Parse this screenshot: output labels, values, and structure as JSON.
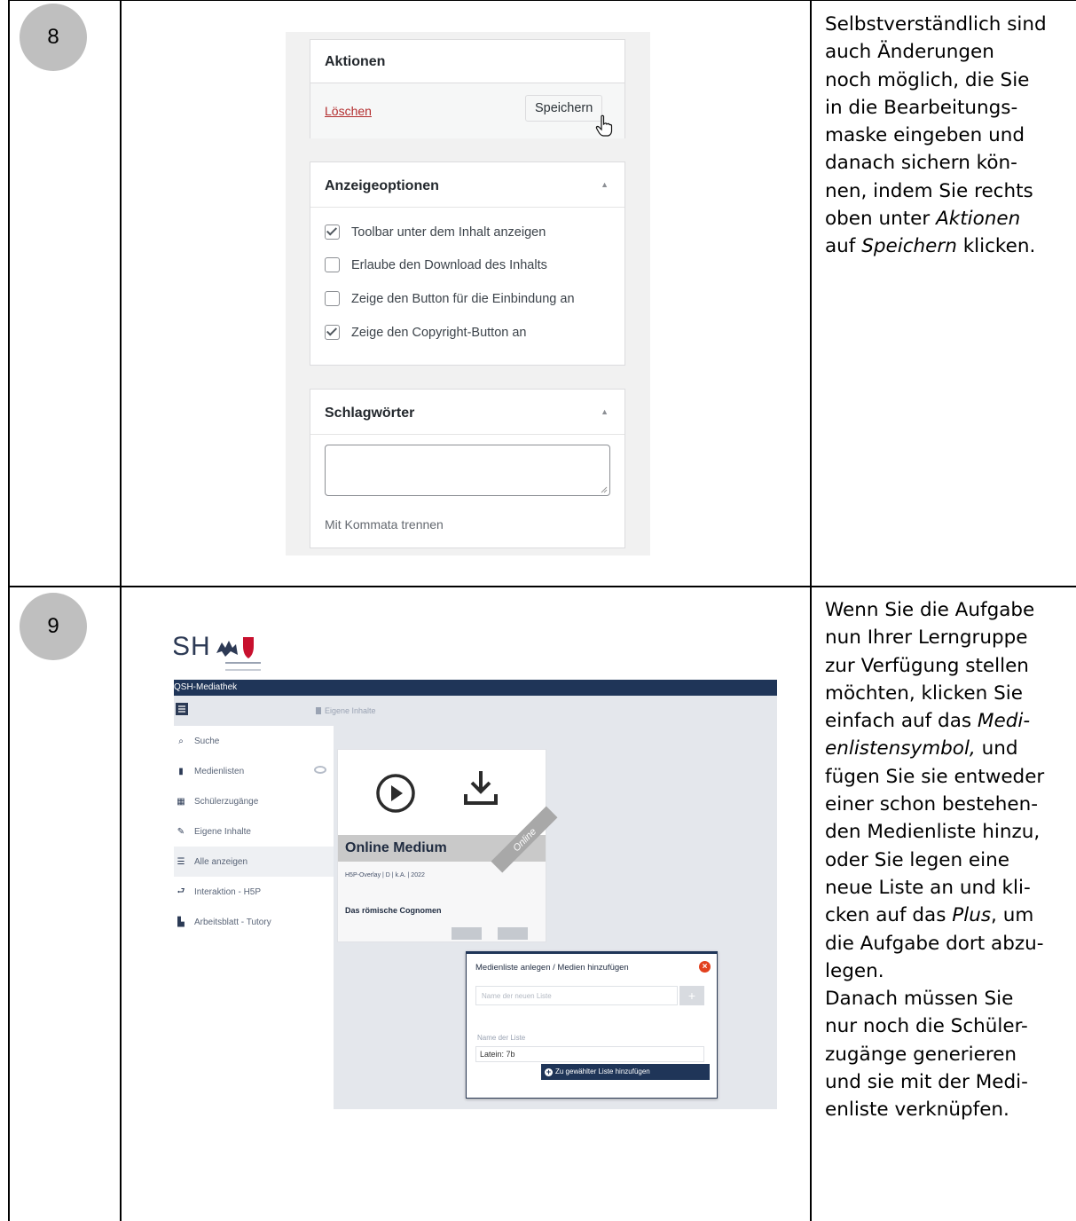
{
  "rows": [
    {
      "number": "8"
    },
    {
      "number": "9"
    }
  ],
  "step8": {
    "aktionen": {
      "title": "Aktionen",
      "delete_link": "Löschen",
      "save_button": "Speichern"
    },
    "anzeigeoptionen": {
      "title": "Anzeigeoptionen",
      "options": [
        {
          "label": "Toolbar unter dem Inhalt anzeigen",
          "checked": true
        },
        {
          "label": "Erlaube den Download des Inhalts",
          "checked": false
        },
        {
          "label": "Zeige den Button für die Einbindung an",
          "checked": false
        },
        {
          "label": "Zeige den Copyright-Button an",
          "checked": true
        }
      ]
    },
    "schlagwoerter": {
      "title": "Schlagwörter",
      "hint": "Mit Kommata trennen"
    },
    "description_lines": [
      "Selbstverständlich sind",
      "auch Änderungen",
      "noch möglich, die Sie",
      "in die Bearbeitungs-",
      "maske eingeben und",
      "danach sichern kön-",
      "nen, indem Sie rechts"
    ],
    "description_tail": {
      "l8_a": "oben unter ",
      "l8_em": "Aktionen",
      "l9_a": "auf ",
      "l9_em": "Speichern",
      "l9_b": " klicken."
    }
  },
  "step9": {
    "logo": "SH",
    "app_title": "QSH-Mediathek",
    "breadcrumb": "Eigene Inhalte",
    "nav": [
      {
        "label": "Suche",
        "icon": "search-icon"
      },
      {
        "label": "Medienlisten",
        "icon": "bookmark-icon"
      },
      {
        "label": "Schülerzugänge",
        "icon": "table-icon"
      },
      {
        "label": "Eigene Inhalte",
        "icon": "pencil-icon"
      },
      {
        "label": "Alle anzeigen",
        "icon": "list-icon"
      },
      {
        "label": "Interaktion - H5P",
        "icon": "return-icon"
      },
      {
        "label": "Arbeitsblatt - Tutory",
        "icon": "document-icon"
      }
    ],
    "card": {
      "title": "Online Medium",
      "ribbon": "Online",
      "meta": "H5P-Overlay | D | k.A. | 2022",
      "subtitle": "Das römische Cognomen"
    },
    "popup": {
      "title": "Medienliste anlegen / Medien hinzufügen",
      "new_list_placeholder": "Name der neuen Liste",
      "list_label": "Name der Liste",
      "list_value": "Latein: 7b",
      "add_button": "Zu gewählter Liste hinzufügen"
    },
    "description": {
      "lines": [
        "Wenn Sie die Aufgabe",
        "nun Ihrer Lerngruppe",
        "zur Verfügung stellen",
        "möchten, klicken Sie"
      ],
      "l5_a": "einfach auf das ",
      "l5_em": "Medi-",
      "l6_em": "enlistensymbol,",
      "l6_b": " und",
      "lines_b": [
        "fügen Sie sie entweder",
        "einer schon bestehen-",
        "den Medienliste hinzu,",
        "oder Sie legen eine",
        "neue Liste an und kli-"
      ],
      "l12_a": "cken auf das ",
      "l12_em": "Plus",
      "l12_b": ", um",
      "lines_c": [
        "die Aufgabe dort abzu-",
        "legen.",
        "Danach müssen Sie",
        "nur noch die Schüler-",
        "zugänge generieren",
        "und sie mit der Medi-",
        "enliste verknüpfen."
      ]
    }
  }
}
